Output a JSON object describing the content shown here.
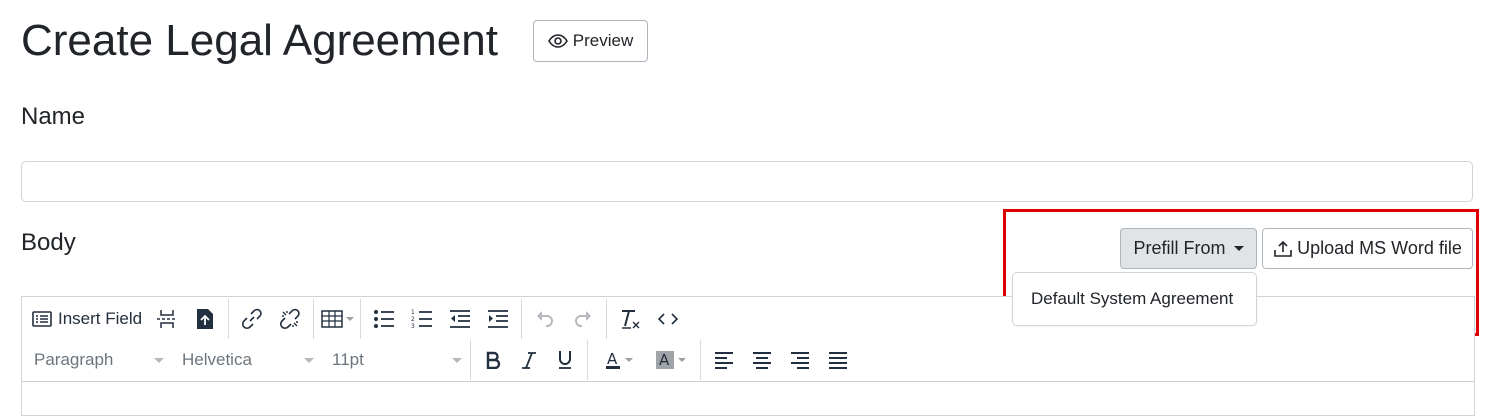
{
  "page": {
    "title": "Create Legal Agreement",
    "preview_label": "Preview"
  },
  "form": {
    "name_label": "Name",
    "name_value": "",
    "body_label": "Body",
    "prefill_label": "Prefill From",
    "upload_label": "Upload MS Word file",
    "prefill_menu": {
      "items": [
        "Default System Agreement"
      ]
    }
  },
  "editor": {
    "toolbar": {
      "insert_field_label": "Insert Field",
      "block_format": "Paragraph",
      "font_family": "Helvetica",
      "font_size": "11pt"
    }
  },
  "icons": {
    "preview": "eye-icon",
    "upload": "upload-icon",
    "insert_field": "insert-field-icon",
    "page_break": "page-break-icon",
    "import": "import-document-icon",
    "link": "link-icon",
    "unlink": "unlink-icon",
    "table": "table-icon",
    "bullets": "bullet-list-icon",
    "numbers": "numbered-list-icon",
    "outdent": "outdent-icon",
    "indent": "indent-icon",
    "undo": "undo-icon",
    "redo": "redo-icon",
    "clear_format": "clear-formatting-icon",
    "code": "source-code-icon"
  },
  "colors": {
    "highlight": "#e00000",
    "text_color_swatch": "#222f3e",
    "bg_color_swatch": "#a0a4a8"
  }
}
